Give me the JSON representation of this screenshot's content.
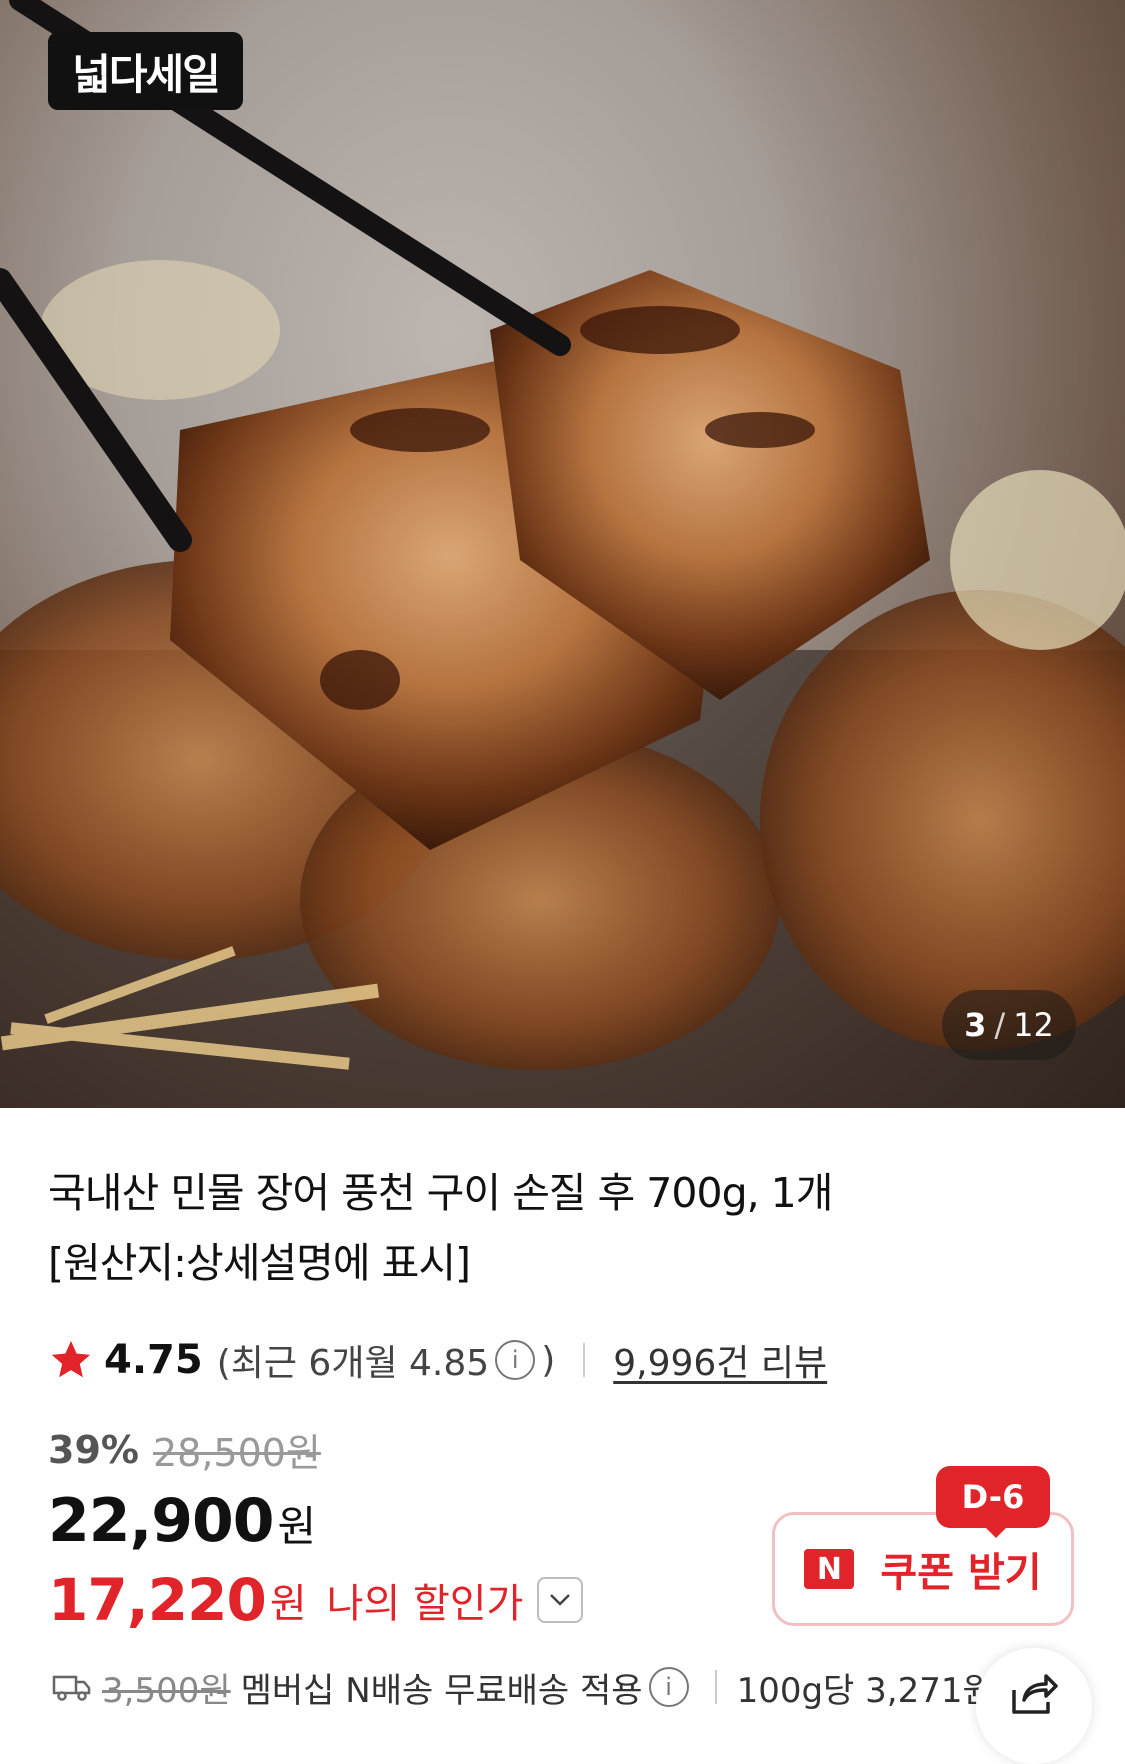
{
  "brand": {
    "badge_text": "넓다세일"
  },
  "gallery": {
    "current": "3",
    "separator": "/",
    "total": "12"
  },
  "product": {
    "title_line1": "국내산 민물 장어 풍천 구이 손질 후 700g, 1개",
    "title_line2": "[원산지:상세설명에 표시]"
  },
  "rating": {
    "score": "4.75",
    "recent_prefix": "(최근 6개월 4.85",
    "recent_suffix": ")",
    "review_count": "9,996건 리뷰"
  },
  "price": {
    "discount_rate": "39%",
    "original": "28,500원",
    "sale": "22,900",
    "sale_unit": "원",
    "my_price": "17,220",
    "my_unit": "원",
    "my_label": "나의 할인가"
  },
  "coupon": {
    "n_label": "N",
    "label": "쿠폰 받기",
    "dday": "D-6"
  },
  "shipping": {
    "original_fee": "3,500원",
    "text": "멤버십 N배송 무료배송 적용",
    "unit_price": "100g당 3,271원"
  },
  "colors": {
    "accent_red": "#e0242a",
    "star": "#e0242a"
  },
  "icons": [
    "star-icon",
    "info-icon",
    "chevron-down-icon",
    "truck-icon",
    "share-icon"
  ]
}
